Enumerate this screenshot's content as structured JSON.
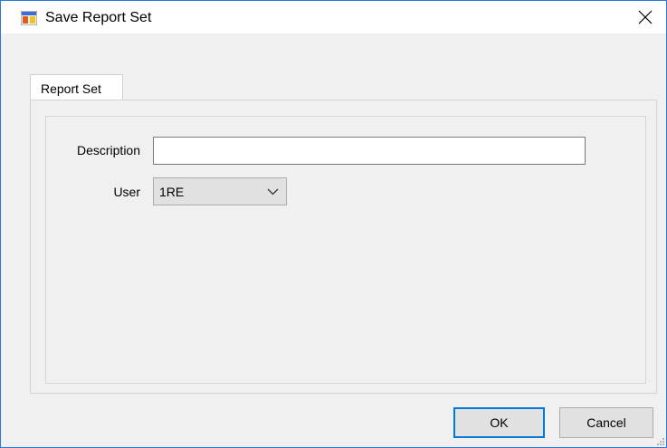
{
  "window": {
    "title": "Save Report Set",
    "title_icon": "report-set-app-icon",
    "close_icon": "close-icon"
  },
  "tabs": [
    {
      "label": "Report Set",
      "selected": true
    }
  ],
  "form": {
    "description_label": "Description",
    "description_value": "",
    "user_label": "User",
    "user_value": "1RE"
  },
  "buttons": {
    "ok_label": "OK",
    "cancel_label": "Cancel"
  },
  "colors": {
    "accent": "#0078d7",
    "window_border": "#2b79d6",
    "dialog_background": "#f0f0f0"
  }
}
